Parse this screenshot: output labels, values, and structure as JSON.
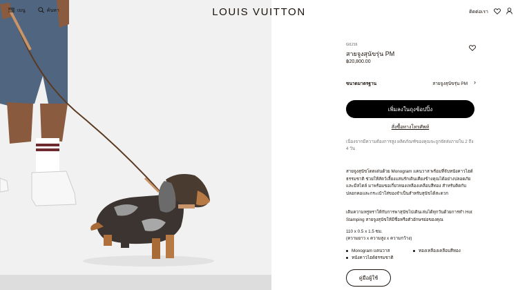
{
  "header": {
    "brand": "LOUIS VUITTON",
    "menu_label": "เมนู",
    "search_label": "ค้นหา",
    "contact_label": "ติดต่อเรา"
  },
  "product": {
    "sku": "GI1216",
    "title": "สายจูงสุนัขรุ่น PM",
    "price": "฿20,800.00",
    "size_label": "ขนาดมาตรฐาน",
    "size_value": "สายจูงสุนัขรุ่น PM",
    "add_to_bag": "เพิ่มลงในถุงช้อปปิ้ง",
    "order_by_phone": "สั่งซื้อทางโทรศัพท์",
    "notice": "เนื่องจากมีความต้องการสูง ผลิตภัณฑ์ของคุณจะถูกจัดส่งภายใน 2 ถึง 4 วัน",
    "description": "สายจูงสุนัขโดดเด่นด้วย Monogram แคนวาส พร้อมที่จับหนังคาวไฮด์ธรรมชาติ ช่วยให้สัตว์เลี้ยงแสนรักเดินเคียงข้างคุณได้อย่างปลอดภัยและมีสไตล์ มาพร้อมขอเกี่ยวทองเหลืองเคลือบสีทอง สำหรับติดกับปลอกคอและกระเป๋าใส่ของจำเป็นสำหรับสุนัขได้สะดวก",
    "personalization": "เติมความหรูหราให้กับการพาสุนัขไปเดินเล่นได้ทุกวันด้วยการทำ Hot Stamping สายจูงสุนัขให้มีชื่อหรือตัวอักษรย่อของคุณ",
    "dimensions": "110 x 0.5 x 1.5 ซม.",
    "dimensions_note": "(ความยาว x ความสูง x ความกว้าง)",
    "features": [
      "Monogram แคนวาส",
      "ทองเหลืองเคลือบสีทอง",
      "หนังคาวไฮด์ธรรมชาติ"
    ],
    "size_guide": "คู่มือผู้ใช้"
  },
  "icons": {
    "menu": "menu-icon",
    "search": "search-icon",
    "wishlist": "heart-icon",
    "account": "user-icon"
  },
  "colors": {
    "text": "#19110b",
    "button": "#000000",
    "muted": "#757575"
  }
}
